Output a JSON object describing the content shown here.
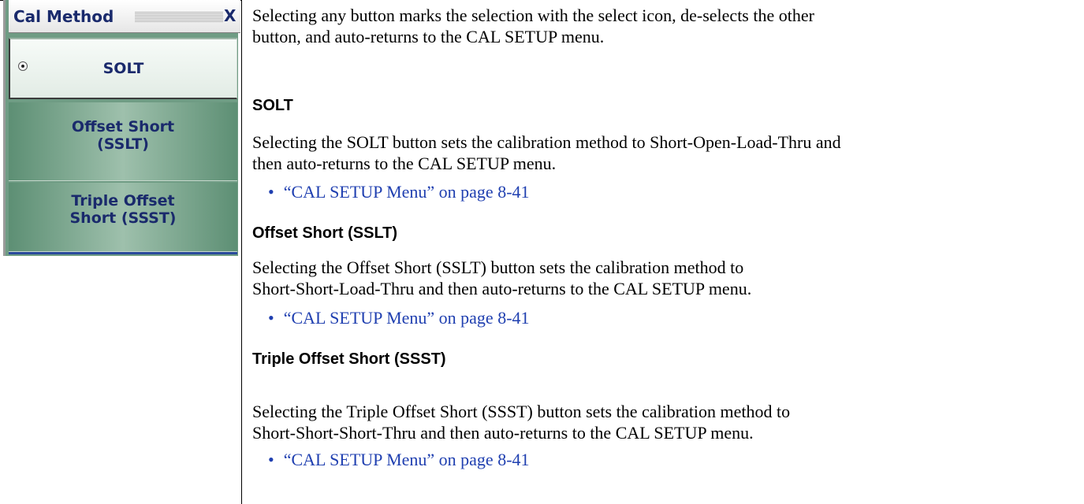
{
  "menu": {
    "title": "Cal Method",
    "close_label": "X",
    "buttons": [
      {
        "label": "SOLT",
        "selected": true
      },
      {
        "label_line1": "Offset Short",
        "label_line2": "(SSLT)"
      },
      {
        "label_line1": "Triple Offset",
        "label_line2": "Short (SSST)"
      }
    ]
  },
  "content": {
    "intro_line1": "Selecting any button marks the selection with the select icon, de-selects the other",
    "intro_line2": "button, and auto-returns to the CAL SETUP menu.",
    "sections": [
      {
        "heading": "SOLT",
        "line1": "Selecting the SOLT button sets the calibration method to Short-Open-Load-Thru and",
        "line2": "then auto-returns to the CAL SETUP menu.",
        "link": "“CAL SETUP Menu” on page 8-41"
      },
      {
        "heading": "Offset Short (SSLT)",
        "line1": "Selecting the Offset Short (SSLT) button sets the calibration method to",
        "line2": "Short-Short-Load-Thru and then auto-returns to the CAL SETUP menu.",
        "link": "“CAL SETUP Menu” on page 8-41"
      },
      {
        "heading": "Triple Offset Short (SSST)",
        "line1": "Selecting the Triple Offset Short (SSST) button sets the calibration method to",
        "line2": "Short-Short-Short-Thru and then auto-returns to the CAL SETUP menu.",
        "link": "“CAL SETUP Menu” on page 8-41"
      }
    ]
  }
}
